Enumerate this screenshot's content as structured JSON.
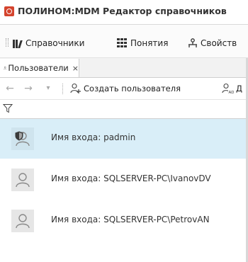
{
  "window": {
    "title": "ПОЛИНОМ:MDM Редактор справочников"
  },
  "menu": {
    "items": [
      {
        "label": "Справочники",
        "icon": "books-icon"
      },
      {
        "label": "Понятия",
        "icon": "grid-icon"
      },
      {
        "label": "Свойств",
        "icon": "person-tree-icon"
      }
    ]
  },
  "tabs": [
    {
      "label": "Пользователи",
      "close": "×"
    }
  ],
  "toolbar": {
    "back": "←",
    "forward": "→",
    "history": "▾",
    "create_user_label": "Создать пользователя",
    "ad_label": "Д"
  },
  "filter": {
    "value": "",
    "placeholder": ""
  },
  "users": [
    {
      "label": "Имя входа: padmin",
      "selected": true,
      "admin": true
    },
    {
      "label": "Имя входа: SQLSERVER-PC\\IvanovDV",
      "selected": false,
      "admin": false
    },
    {
      "label": "Имя входа: SQLSERVER-PC\\PetrovAN",
      "selected": false,
      "admin": false
    }
  ],
  "colors": {
    "accent": "#d4442e",
    "selection": "#d9eef8",
    "shield": "#3a3a3a"
  }
}
